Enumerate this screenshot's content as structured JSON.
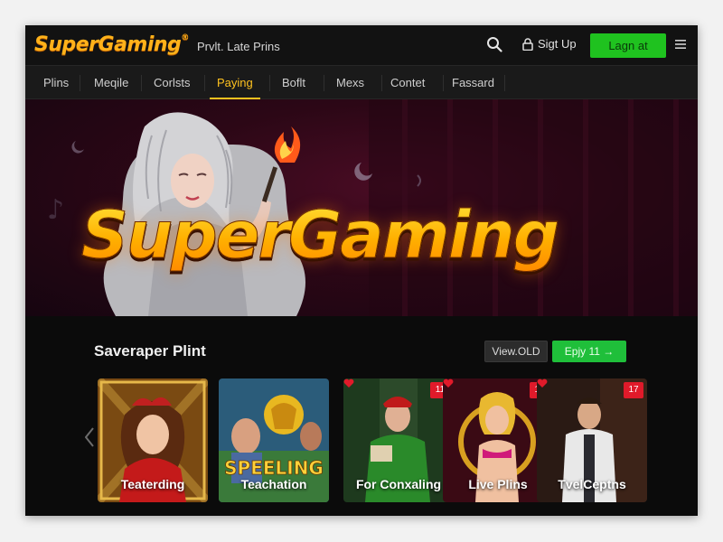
{
  "header": {
    "logo": "SuperGaming",
    "logo_mark": "®",
    "tagline": "Prvlt. Late Prins",
    "signup_label": "Sigt Up",
    "login_label": "Lagn at",
    "icons": [
      "search-icon",
      "lock-icon",
      "hamburger-menu-icon"
    ]
  },
  "nav": {
    "tabs": [
      {
        "label": "Plins",
        "active": false
      },
      {
        "label": "Meqile",
        "active": false
      },
      {
        "label": "Corlsts",
        "active": false
      },
      {
        "label": "Paying",
        "active": true
      },
      {
        "label": "Boflt",
        "active": false
      },
      {
        "label": "Mexs",
        "active": false
      },
      {
        "label": "Contet",
        "active": false
      },
      {
        "label": "Fassard",
        "active": false
      }
    ]
  },
  "hero": {
    "title": "SuperGaming"
  },
  "section": {
    "title": "Saveraper Plint",
    "view_label": "View.OLD",
    "enjoy_label": "Epjy 11 →"
  },
  "cards": [
    {
      "label": "Teaterding",
      "badge": ""
    },
    {
      "label": "Teachation",
      "badge": ""
    },
    {
      "label": "For Conxaling",
      "badge": "11"
    },
    {
      "label": "Live Plins",
      "badge": "12"
    },
    {
      "label": "TvelCeptns",
      "badge": "17"
    }
  ],
  "colors": {
    "accent": "#ffc21f",
    "login_green": "#1fc21f",
    "badge_red": "#e01a2a",
    "hero_bg": "#2c0716"
  }
}
